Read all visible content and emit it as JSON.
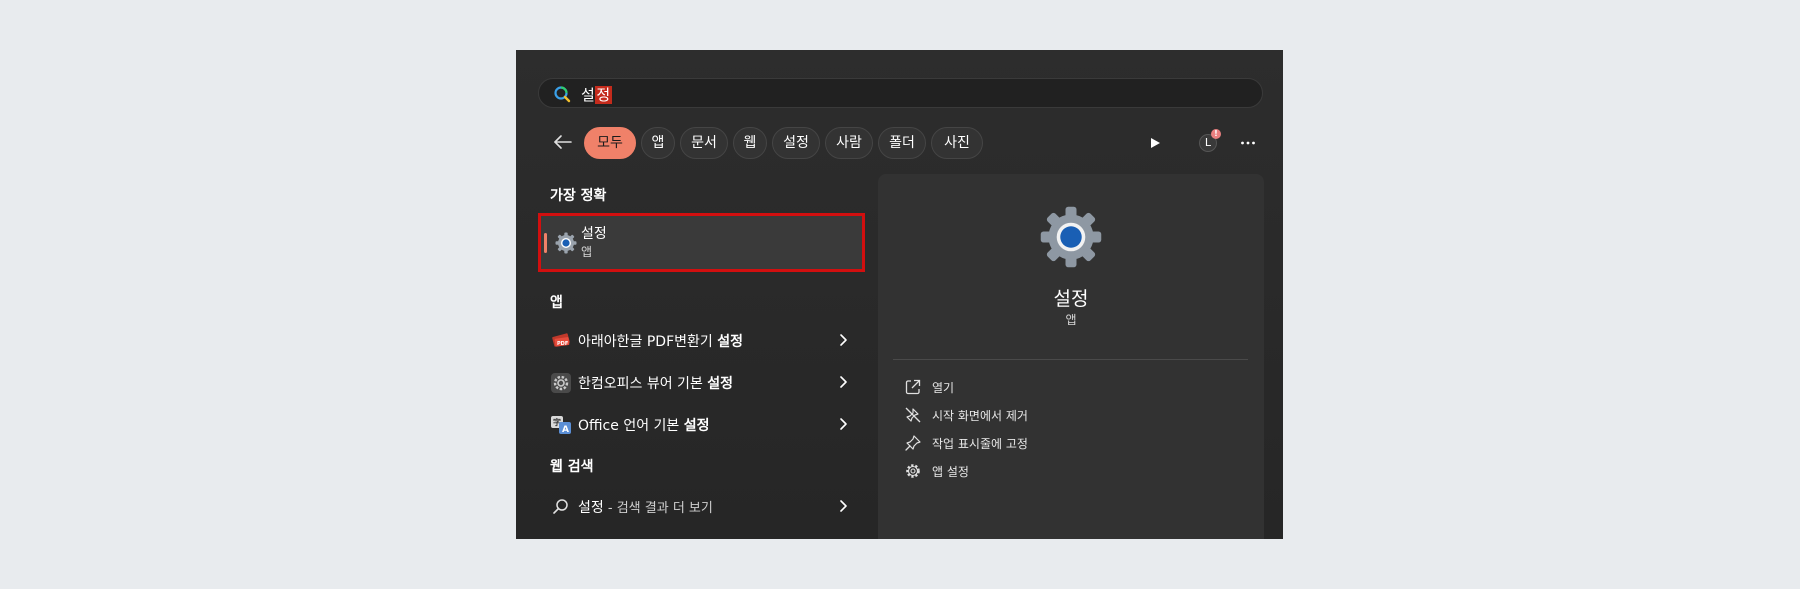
{
  "search": {
    "query_unselected": "설",
    "query_selected": "정"
  },
  "filters": {
    "chips": [
      "모두",
      "앱",
      "문서",
      "웹",
      "설정",
      "사람",
      "폴더",
      "사진"
    ],
    "active": "모두",
    "account_initial": "L"
  },
  "best_match": {
    "section_label": "가장 정확",
    "title": "설정",
    "subtitle": "앱"
  },
  "apps": {
    "section_label": "앱",
    "items": [
      {
        "label_prefix": "아래아한글 PDF변환기 ",
        "label_bold": "설정",
        "icon": "pdf-converter-icon"
      },
      {
        "label_prefix": "한컴오피스 뷰어 기본 ",
        "label_bold": "설정",
        "icon": "hancom-settings-icon"
      },
      {
        "label_prefix": "Office 언어 기본 ",
        "label_bold": "설정",
        "icon": "office-language-icon"
      }
    ]
  },
  "web": {
    "section_label": "웹 검색",
    "item_bold": "설정",
    "item_rest": " - 검색 결과 더 보기"
  },
  "detail": {
    "title": "설정",
    "subtitle": "앱",
    "actions": [
      {
        "label": "열기",
        "icon": "open-external-icon"
      },
      {
        "label": "시작 화면에서 제거",
        "icon": "unpin-icon"
      },
      {
        "label": "작업 표시줄에 고정",
        "icon": "pin-icon"
      },
      {
        "label": "앱 설정",
        "icon": "gear-icon"
      }
    ]
  },
  "colors": {
    "accent": "#f08169",
    "highlight_box": "#d20f0f",
    "selection": "#c42b1c",
    "settings_blue": "#1a5fb4"
  }
}
